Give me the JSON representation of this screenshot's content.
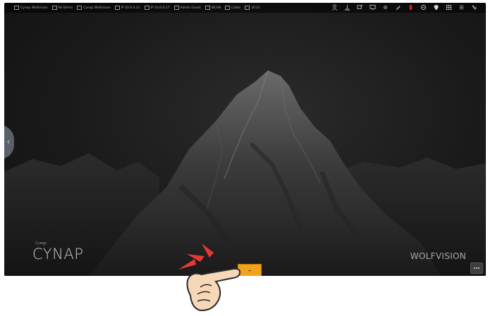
{
  "status_bar": {
    "items": [
      "Cynap Wolfvision",
      "Re Demo",
      "Cynap Wolfvision",
      "IP 10.0.0.21",
      "IP 10.0.0.27",
      "Admin Guest",
      "WLAN",
      "Cable",
      "10:21"
    ],
    "right_icons": [
      "user-icon",
      "network-icon",
      "share-icon",
      "monitor-icon",
      "settings-icon",
      "pen-icon",
      "record-icon",
      "link-icon",
      "shield-icon",
      "grid-icon",
      "list-icon",
      "annotate-icon"
    ],
    "record_color": "#d21f1f"
  },
  "branding": {
    "wordmark_small": "Cynap",
    "wordmark": "CYNAP",
    "vendor": "WOLFVISION"
  },
  "controls": {
    "side_handle_glyph": "‹",
    "home_button_color": "#f0a31c"
  }
}
